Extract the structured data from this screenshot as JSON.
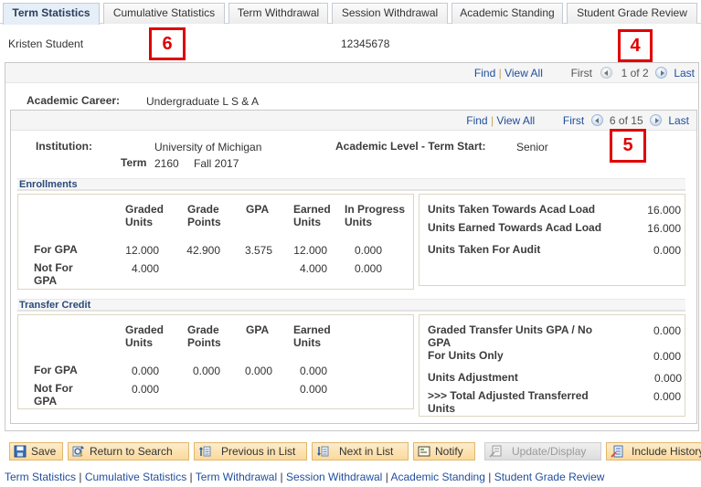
{
  "tabs": [
    {
      "label": "Term Statistics",
      "active": true
    },
    {
      "label": "Cumulative Statistics",
      "active": false
    },
    {
      "label": "Term Withdrawal",
      "active": false
    },
    {
      "label": "Session Withdrawal",
      "active": false
    },
    {
      "label": "Academic Standing",
      "active": false
    },
    {
      "label": "Student Grade Review",
      "active": false
    }
  ],
  "student": {
    "name": "Kristen Student",
    "id": "12345678"
  },
  "callouts": {
    "a": "6",
    "b": "4",
    "c": "5"
  },
  "outer_nav": {
    "find": "Find",
    "sep": "|",
    "view_all": "View All",
    "first": "First",
    "position": "1 of 2",
    "last": "Last"
  },
  "career": {
    "label": "Academic Career:",
    "value": "Undergraduate L S & A"
  },
  "inner_nav": {
    "find": "Find",
    "sep": "|",
    "view_all": "View All",
    "first": "First",
    "position": "6 of 15",
    "last": "Last"
  },
  "term_info": {
    "institution_label": "Institution:",
    "institution": "University of Michigan",
    "level_label": "Academic Level - Term Start:",
    "level": "Senior",
    "term_label": "Term",
    "term_code": "2160",
    "term_name": "Fall 2017"
  },
  "enrollments": {
    "title": "Enrollments",
    "columns": [
      "Graded Units",
      "Grade Points",
      "GPA",
      "Earned Units",
      "In Progress Units"
    ],
    "rows": [
      {
        "label": "For GPA",
        "values": [
          "12.000",
          "42.900",
          "3.575",
          "12.000",
          "0.000"
        ]
      },
      {
        "label": "Not For GPA",
        "values": [
          "4.000",
          "",
          "",
          "4.000",
          "0.000"
        ]
      }
    ],
    "summary": [
      {
        "label": "Units Taken Towards Acad Load",
        "value": "16.000"
      },
      {
        "label": "Units Earned Towards Acad Load",
        "value": "16.000"
      },
      {
        "label": "Units Taken For Audit",
        "value": "0.000"
      }
    ]
  },
  "transfer": {
    "title": "Transfer Credit",
    "columns": [
      "Graded Units",
      "Grade Points",
      "GPA",
      "Earned Units"
    ],
    "rows": [
      {
        "label": "For GPA",
        "values": [
          "0.000",
          "0.000",
          "0.000",
          "0.000"
        ]
      },
      {
        "label": "Not For GPA",
        "values": [
          "0.000",
          "",
          "",
          "0.000"
        ]
      }
    ],
    "summary": [
      {
        "label": "Graded Transfer Units GPA / No GPA",
        "value": "0.000"
      },
      {
        "label": "For Units Only",
        "value": "0.000"
      },
      {
        "label": "Units Adjustment",
        "value": "0.000"
      },
      {
        "label": ">>> Total Adjusted Transferred Units",
        "value": "0.000"
      }
    ]
  },
  "buttons": [
    {
      "label": "Save",
      "icon": "save-icon",
      "enabled": true
    },
    {
      "label": "Return to Search",
      "icon": "return-to-search-icon",
      "enabled": true
    },
    {
      "label": "Previous in List",
      "icon": "previous-in-list-icon",
      "enabled": true
    },
    {
      "label": "Next in List",
      "icon": "next-in-list-icon",
      "enabled": true
    },
    {
      "label": "Notify",
      "icon": "notify-icon",
      "enabled": true
    },
    {
      "label": "Update/Display",
      "icon": "update-display-icon",
      "enabled": false
    },
    {
      "label": "Include History",
      "icon": "include-history-icon",
      "enabled": true
    }
  ],
  "footer_links": [
    "Term Statistics",
    "Cumulative Statistics",
    "Term Withdrawal",
    "Session Withdrawal",
    "Academic Standing",
    "Student Grade Review"
  ],
  "colors": {
    "link": "#1f4e9c",
    "callout": "#e00000",
    "button_bg": "#fbd99a",
    "active_tab": "#e6eef7"
  }
}
